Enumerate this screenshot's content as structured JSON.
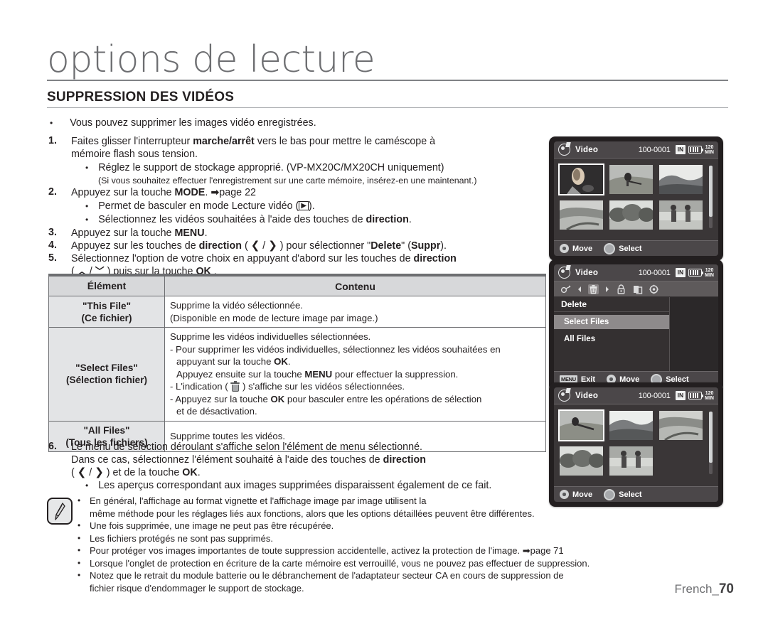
{
  "header": {
    "chapter_title": "options de lecture",
    "section_title": "SUPPRESSION DES VIDÉOS",
    "intro_bullet": "Vous pouvez supprimer les images vidéo enregistrées."
  },
  "steps": {
    "s1_num": "1.",
    "s1_a": "Faites glisser l'interrupteur ",
    "s1_b": "marche/arrêt",
    "s1_c": " vers le bas pour mettre le caméscope à",
    "s1_line2": "mémoire flash sous tension.",
    "s1_bullet": "Réglez le support de stockage approprié. (VP-MX20C/MX20CH uniquement)",
    "s1_paren": "(Si vous souhaitez effectuer l'enregistrement sur une carte mémoire, insérez-en une maintenant.)",
    "s2_num": "2.",
    "s2_a": "Appuyez sur la touche ",
    "s2_b": "MODE",
    "s2_c": ". ",
    "s2_page": "page 22",
    "s2_bullet1_a": "Permet de basculer en mode Lecture vidéo (",
    "s2_bullet1_b": ").",
    "s2_bullet2_a": "Sélectionnez les vidéos souhaitées à l'aide des touches de ",
    "s2_bullet2_b": "direction",
    "s2_bullet2_c": ".",
    "s3_num": "3.",
    "s3_a": "Appuyez sur la touche ",
    "s3_b": "MENU",
    "s3_c": ".",
    "s4_num": "4.",
    "s4_a": "Appuyez sur les touches de ",
    "s4_b": "direction",
    "s4_c": " ( ",
    "s4_arrow_left": "❮",
    "s4_slash": " / ",
    "s4_arrow_right": "❯",
    "s4_d": " ) pour sélectionner \"",
    "s4_e": "Delete",
    "s4_f": "\" (",
    "s4_g": "Suppr",
    "s4_h": ").",
    "s5_num": "5.",
    "s5_a": "Sélectionnez l'option de votre choix en appuyant d'abord sur les touches de ",
    "s5_b": "direction",
    "s5_line2_a": "( ",
    "s5_up": "︿",
    "s5_down": "﹀",
    "s5_line2_b": " ) puis sur la touche ",
    "s5_ok": "OK",
    "s5_line2_c": " .",
    "s6_num": "6.",
    "s6_line1": "Le menu de sélection déroulant s'affiche selon l'élément de menu sélectionné.",
    "s6_line2_a": "Dans ce cas, sélectionnez l'élément souhaité à l'aide des touches de ",
    "s6_line2_b": "direction",
    "s6_line3_a": "( ",
    "s6_line3_b": " ) et de la touche ",
    "s6_line3_ok": "OK",
    "s6_line3_c": ".",
    "s6_bullet": "Les aperçus correspondant aux images supprimées disparaissent également de ce fait."
  },
  "table": {
    "headers": [
      "Élément",
      "Contenu"
    ],
    "rows": [
      {
        "item_en": "\"This File\"",
        "item_fr": "(Ce fichier)",
        "lines": [
          {
            "kind": "plain",
            "text": "Supprime la vidéo sélectionnée."
          },
          {
            "kind": "plain",
            "text": "(Disponible en mode de lecture image par image.)"
          }
        ]
      },
      {
        "item_en": "\"Select Files\"",
        "item_fr": "(Sélection fichier)",
        "lines": [
          {
            "kind": "plain",
            "text": "Supprime les vidéos individuelles sélectionnées."
          },
          {
            "kind": "dash",
            "a": "- Pour supprimer les vidéos individuelles, sélectionnez les vidéos souhaitées en"
          },
          {
            "kind": "ind",
            "a": "appuyant sur la touche ",
            "b": "OK",
            "c": "."
          },
          {
            "kind": "ind",
            "a": "Appuyez ensuite sur la touche ",
            "b": "MENU",
            "c": " pour effectuer la suppression."
          },
          {
            "kind": "dash-trash",
            "a": "- L'indication ( ",
            "c": " ) s'affiche sur les vidéos sélectionnées."
          },
          {
            "kind": "dash",
            "a": "- Appuyez sur la touche ",
            "b": "OK",
            "c": " pour basculer entre les opérations de sélection"
          },
          {
            "kind": "ind",
            "a": "et de désactivation."
          }
        ]
      },
      {
        "item_en": "\"All Files\"",
        "item_fr": "(Tous les fichiers)",
        "lines": [
          {
            "kind": "plain",
            "text": "Supprime toutes les vidéos."
          }
        ]
      }
    ]
  },
  "notes": {
    "icon_name": "note-pen-icon",
    "items": [
      "En général, l'affichage au format vignette et l'affichage image par image utilisent la",
      "même méthode pour les réglages liés aux fonctions, alors que les options détaillées peuvent être différentes.",
      "Une fois supprimée, une image ne peut pas être récupérée.",
      "Les fichiers protégés ne sont pas supprimés.",
      "Pour protéger vos images importantes de toute suppression accidentelle, activez la protection de l'image. ➡page 71",
      "Lorsque l'onglet de protection en écriture de la carte mémoire est verrouillé, vous ne pouvez pas effectuer de suppression.",
      "Notez que le retrait du module batterie ou le débranchement de l'adaptateur secteur CA en cours de suppression de",
      "fichier risque d'endommager le support de stockage."
    ]
  },
  "footer": {
    "language": "French_",
    "page": "70"
  },
  "lcd_common": {
    "title": "Video",
    "file_number": "100-0001",
    "memory_badge": "IN",
    "minutes_top": "120",
    "minutes_bottom": "MIN",
    "move_label": "Move",
    "select_label": "Select",
    "exit_label": "Exit",
    "menu_key_label": "MENU"
  },
  "lcd_panels": [
    {
      "name": "thumbnail-view-before",
      "thumb_count": 6,
      "selected_index": 0,
      "rows": [
        [
          "thumb-person-dark",
          "thumb-cyclist",
          "thumb-mountain"
        ],
        [
          "thumb-valley",
          "thumb-trees",
          "thumb-two-people"
        ]
      ]
    },
    {
      "name": "delete-menu",
      "menu_icons": [
        "play-edit-icon",
        "left-arrow-icon",
        "trash-icon",
        "right-arrow-icon",
        "lock-icon",
        "copy-icon",
        "gear-icon"
      ],
      "menu_title": "Delete",
      "menu_items": [
        {
          "label": "Select Files",
          "highlighted": true
        },
        {
          "label": "All Files",
          "highlighted": false
        }
      ]
    },
    {
      "name": "thumbnail-view-after",
      "thumb_count": 5,
      "selected_index": 0,
      "rows": [
        [
          "thumb-cyclist",
          "thumb-mountain",
          "thumb-valley"
        ],
        [
          "thumb-trees",
          "thumb-two-people",
          null
        ]
      ]
    }
  ],
  "colors": {
    "heading_gray": "#6d6e71",
    "text_black": "#231f20",
    "table_header_bg": "#d7d8da",
    "table_item_bg": "#e3e4e6",
    "lcd_bezel": "#231f20",
    "lcd_bar": "#4b4749",
    "lcd_highlight": "#8e8a8b"
  }
}
